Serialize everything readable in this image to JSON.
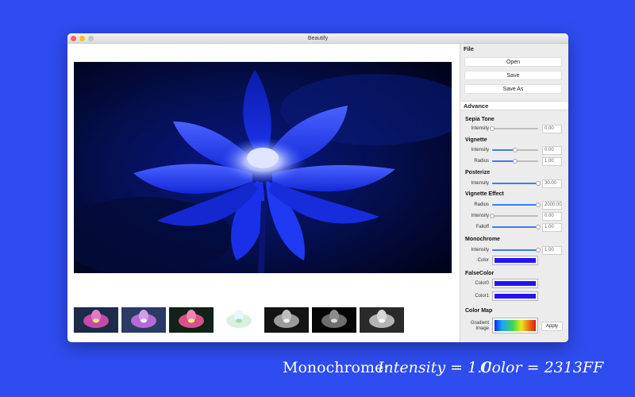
{
  "window": {
    "title": "Beautify"
  },
  "sidebar": {
    "file": {
      "title": "File",
      "buttons": [
        "Open",
        "Save",
        "Save As"
      ]
    },
    "advance": {
      "title": "Advance",
      "sepia_tone": {
        "title": "Sepia Tone",
        "intensity_label": "Intensity",
        "intensity_value": "0.00",
        "intensity_level": 0.0
      },
      "vignette": {
        "title": "Vignette",
        "intensity_label": "Intensity",
        "intensity_value": "0.00",
        "intensity_level": 0.5,
        "radius_label": "Radius",
        "radius_value": "1.00",
        "radius_level": 0.5
      },
      "posterize": {
        "title": "Posterize",
        "intensity_label": "Intensity",
        "intensity_value": "30.00",
        "intensity_level": 1.0
      },
      "vignette_effect": {
        "title": "Vignette Effect",
        "radius_label": "Radius",
        "radius_value": "2000.00",
        "radius_level": 1.0,
        "intensity_label": "Intensity",
        "intensity_value": "0.00",
        "intensity_level": 0.0,
        "falloff_label": "Falloff",
        "falloff_value": "1.00",
        "falloff_level": 1.0
      },
      "monochrome": {
        "title": "Monochrome",
        "intensity_label": "Intensity",
        "intensity_value": "1.00",
        "intensity_level": 1.0,
        "color_label": "Color",
        "color": "#2313FF"
      },
      "false_color": {
        "title": "FalseColor",
        "color0_label": "Color0",
        "color0": "#2313FF",
        "color1_label": "Color1",
        "color1": "#2313FF"
      },
      "color_map": {
        "title": "Color Map",
        "gradient_label": "Gradient Image",
        "apply_label": "Apply"
      }
    }
  },
  "caption": {
    "effect": "Monochrome:",
    "intensity": "Intensity = 1.0",
    "color": "Color = 2313FF"
  },
  "colors": {
    "background": "#2E4CF0",
    "accent": "#3B7CF2",
    "monochrome": "#2313FF"
  }
}
